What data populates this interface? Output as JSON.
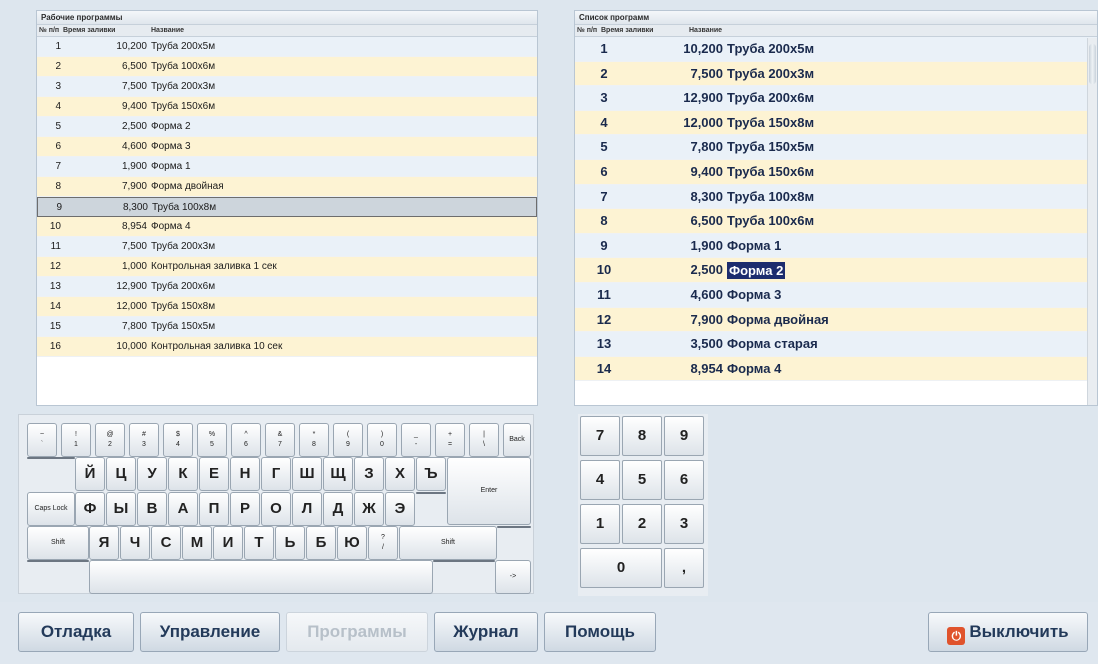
{
  "working_programs": {
    "title": "Рабочие программы",
    "columns": [
      "№ п/п",
      "Время заливки",
      "Название"
    ],
    "rows": [
      {
        "num": "1",
        "time": "10,200",
        "name": "Труба 200х5м"
      },
      {
        "num": "2",
        "time": "6,500",
        "name": "Труба 100х6м"
      },
      {
        "num": "3",
        "time": "7,500",
        "name": "Труба 200х3м"
      },
      {
        "num": "4",
        "time": "9,400",
        "name": "Труба 150х6м"
      },
      {
        "num": "5",
        "time": "2,500",
        "name": "Форма 2"
      },
      {
        "num": "6",
        "time": "4,600",
        "name": "Форма 3"
      },
      {
        "num": "7",
        "time": "1,900",
        "name": "Форма 1"
      },
      {
        "num": "8",
        "time": "7,900",
        "name": "Форма двойная"
      },
      {
        "num": "9",
        "time": "8,300",
        "name": "Труба 100х8м"
      },
      {
        "num": "10",
        "time": "8,954",
        "name": "Форма 4"
      },
      {
        "num": "11",
        "time": "7,500",
        "name": "Труба 200х3м"
      },
      {
        "num": "12",
        "time": "1,000",
        "name": "Контрольная заливка 1 сек"
      },
      {
        "num": "13",
        "time": "12,900",
        "name": "Труба 200х6м"
      },
      {
        "num": "14",
        "time": "12,000",
        "name": "Труба 150х8м"
      },
      {
        "num": "15",
        "time": "7,800",
        "name": "Труба 150х5м"
      },
      {
        "num": "16",
        "time": "10,000",
        "name": "Контрольная заливка 10 сек"
      }
    ],
    "selected_row": 9
  },
  "program_list": {
    "title": "Список программ",
    "columns": [
      "№ п/п",
      "Время заливки",
      "Название"
    ],
    "rows": [
      {
        "num": "1",
        "time": "10,200",
        "name": "Труба 200х5м"
      },
      {
        "num": "2",
        "time": "7,500",
        "name": "Труба 200х3м"
      },
      {
        "num": "3",
        "time": "12,900",
        "name": "Труба 200х6м"
      },
      {
        "num": "4",
        "time": "12,000",
        "name": "Труба 150х8м"
      },
      {
        "num": "5",
        "time": "7,800",
        "name": "Труба 150х5м"
      },
      {
        "num": "6",
        "time": "9,400",
        "name": "Труба 150х6м"
      },
      {
        "num": "7",
        "time": "8,300",
        "name": "Труба 100х8м"
      },
      {
        "num": "8",
        "time": "6,500",
        "name": "Труба 100х6м"
      },
      {
        "num": "9",
        "time": "1,900",
        "name": "Форма 1"
      },
      {
        "num": "10",
        "time": "2,500",
        "name": "Форма 2"
      },
      {
        "num": "11",
        "time": "4,600",
        "name": "Форма 3"
      },
      {
        "num": "12",
        "time": "7,900",
        "name": "Форма двойная"
      },
      {
        "num": "13",
        "time": "3,500",
        "name": "Форма старая"
      },
      {
        "num": "14",
        "time": "8,954",
        "name": "Форма 4"
      }
    ],
    "highlighted_row": 10
  },
  "keyboard": {
    "number_row": [
      {
        "top": "~",
        "bottom": "`"
      },
      {
        "top": "!",
        "bottom": "1"
      },
      {
        "top": "@",
        "bottom": "2"
      },
      {
        "top": "#",
        "bottom": "3"
      },
      {
        "top": "$",
        "bottom": "4"
      },
      {
        "top": "%",
        "bottom": "5"
      },
      {
        "top": "^",
        "bottom": "6"
      },
      {
        "top": "&",
        "bottom": "7"
      },
      {
        "top": "*",
        "bottom": "8"
      },
      {
        "top": "(",
        "bottom": "9"
      },
      {
        "top": ")",
        "bottom": "0"
      },
      {
        "top": "_",
        "bottom": "-"
      },
      {
        "top": "+",
        "bottom": "="
      },
      {
        "top": "|",
        "bottom": "\\"
      }
    ],
    "back_label": "Back",
    "row1": [
      "Й",
      "Ц",
      "У",
      "К",
      "Е",
      "Н",
      "Г",
      "Ш",
      "Щ",
      "З",
      "Х",
      "Ъ"
    ],
    "enter_label": "Enter",
    "caps_label": "Caps Lock",
    "row2": [
      "Ф",
      "Ы",
      "В",
      "А",
      "П",
      "Р",
      "О",
      "Л",
      "Д",
      "Ж",
      "Э"
    ],
    "shift_label": "Shift",
    "row3": [
      "Я",
      "Ч",
      "С",
      "М",
      "И",
      "Т",
      "Ь",
      "Б",
      "Ю"
    ],
    "row3_extra": {
      "top": "?",
      "bottom": "/"
    },
    "arrow_label": "->"
  },
  "numpad": {
    "keys": [
      "7",
      "8",
      "9",
      "4",
      "5",
      "6",
      "1",
      "2",
      "3"
    ],
    "zero": "0",
    "comma": ","
  },
  "bottom_bar": {
    "debug": "Отладка",
    "control": "Управление",
    "programs": "Программы",
    "journal": "Журнал",
    "help": "Помощь",
    "power": "Выключить"
  },
  "colors": {
    "row_blue": "#eaf1f8",
    "row_yellow": "#fdf3d3",
    "highlight": "#1c2c6e",
    "power_icon": "#e0532c"
  }
}
